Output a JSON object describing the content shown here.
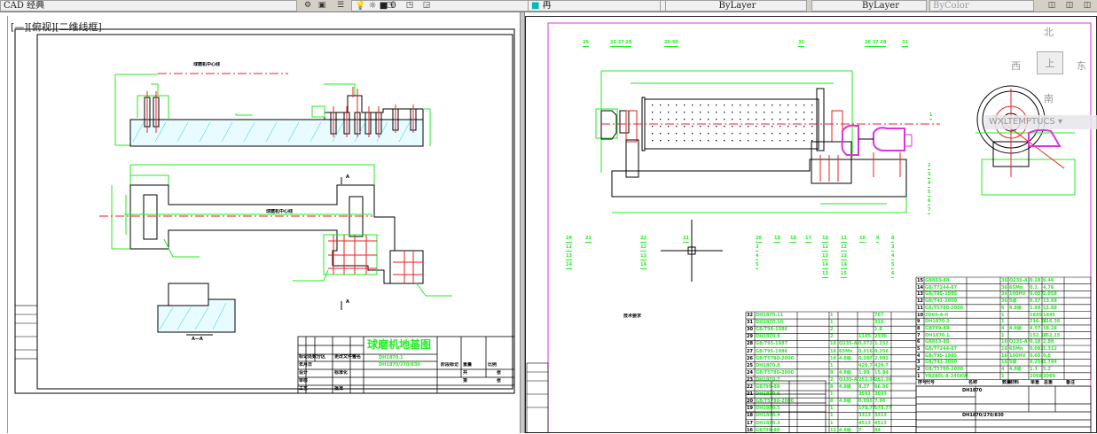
{
  "toolbar": {
    "workspace": "CAD 经典",
    "layer_color": "0",
    "layer_name": "冉",
    "color": "ByLayer",
    "linetype": "ByLayer",
    "lineweight": "ByColor"
  },
  "left_viewport": {
    "label": "[—][俯视][二维线框]",
    "drawing_title": "球磨机地基图",
    "center_label": "球磨机中心线",
    "axis_label": "球磨机中心线",
    "section_label": "A—A",
    "section_mark": "A",
    "title_block": {
      "code": "DH1870.1",
      "subcode": "DH1870/270/830",
      "fields": [
        "标记",
        "处数",
        "分区",
        "更改文件号",
        "签名",
        "年月日",
        "设计",
        "标准化",
        "审核",
        "工艺",
        "批准",
        "阶段标记",
        "重量",
        "比例",
        "共",
        "张",
        "第",
        "张"
      ]
    }
  },
  "right_viewport": {
    "viewcube": {
      "north": "北",
      "south": "南",
      "east": "东",
      "west": "西",
      "top": "上"
    },
    "ucs_label": "WXLTEMPTUCS",
    "balloons_top": [
      "25",
      "26 27 28",
      "29 30",
      "31",
      "26 27 28",
      "32",
      "1"
    ],
    "balloons_bottom": [
      "24",
      "12",
      "13",
      "14",
      "23",
      "22",
      "12",
      "13",
      "14",
      "21",
      "20",
      "3",
      "4",
      "5",
      "19",
      "18",
      "17",
      "16",
      "12",
      "13",
      "14",
      "15",
      "11",
      "12",
      "13",
      "14",
      "15",
      "10",
      "9",
      "8",
      "3",
      "4",
      "5",
      "6"
    ],
    "balloons_right": [
      "2",
      "3",
      "4",
      "5",
      "6",
      "7"
    ],
    "notes_title": "技术要求",
    "parts_list_left": [
      {
        "no": "32",
        "code": "DH1870.11",
        "qty": "1",
        "total": "767"
      },
      {
        "no": "31",
        "code": "DH1870.10",
        "qty": "1",
        "total": "316"
      },
      {
        "no": "30",
        "code": "GB/T98-1986",
        "qty": "2",
        "total": "1.8"
      },
      {
        "no": "29",
        "code": "DH1870.9",
        "qty": "2",
        "unit": "1165",
        "total": "2330"
      },
      {
        "no": "28",
        "code": "GB/T95-1987",
        "qty": "16",
        "material": "Q235-A",
        "unit": "0.072",
        "total": "1.152"
      },
      {
        "no": "27",
        "code": "GB/T95-1986",
        "qty": "16",
        "material": "65Mn",
        "unit": "0.016",
        "total": "0.256"
      },
      {
        "no": "26",
        "code": "GB/T5780-2000",
        "qty": "16",
        "material": "4.8级",
        "unit": "0.187",
        "total": "2.992"
      },
      {
        "no": "25",
        "code": "DH1870.8",
        "qty": "1",
        "unit": "429.7",
        "total": "429.7"
      },
      {
        "no": "24",
        "code": "GB/T5780-2000",
        "qty": "8",
        "material": "4.8级",
        "unit": "1.98",
        "total": "15.84"
      },
      {
        "no": "23",
        "code": "DH1870.7",
        "qty": "2",
        "material": "Q235-A",
        "unit": "252.36",
        "total": "252.36"
      },
      {
        "no": "22",
        "code": "GB799-88",
        "qty": "8",
        "material": "4.8级",
        "unit": "8.37",
        "total": "66.96"
      },
      {
        "no": "21",
        "code": "DH1870.6",
        "qty": "1",
        "unit": "3593",
        "total": "3593"
      },
      {
        "no": "20",
        "code": "GB/T5780-2000",
        "qty": "8",
        "material": "4.8级",
        "unit": "0.995",
        "total": "7.96"
      },
      {
        "no": "19",
        "code": "DH1870.5",
        "qty": "1",
        "unit": "178.77",
        "total": "178.77"
      },
      {
        "no": "18",
        "code": "DH1870.4",
        "qty": "1",
        "unit": "3313",
        "total": "3313"
      },
      {
        "no": "17",
        "code": "DH1870.3",
        "qty": "1",
        "unit": "4513",
        "total": "4513"
      },
      {
        "no": "16",
        "code": "GB799-88",
        "qty": "12",
        "material": "4.8级",
        "unit": "7",
        "total": "84"
      }
    ],
    "parts_list_right": [
      {
        "no": "15",
        "code": "GB853-88",
        "qty": "36",
        "material": "Q235-A",
        "unit": "0.18",
        "total": "6.46"
      },
      {
        "no": "14",
        "code": "GB/T7244-87",
        "qty": "36",
        "material": "65Mn",
        "unit": "0.1",
        "total": "4.76"
      },
      {
        "no": "13",
        "code": "GB/T95-1985",
        "qty": "36",
        "material": "100HV",
        "unit": "0.057",
        "total": "2.058"
      },
      {
        "no": "12",
        "code": "GB/T41-2000",
        "qty": "36",
        "material": "5级",
        "unit": "0.37",
        "total": "13.68"
      },
      {
        "no": "11",
        "code": "GB/T5780-2000",
        "qty": "6",
        "material": "4.8级",
        "unit": "1.98",
        "total": "11.88"
      },
      {
        "no": "10",
        "code": "ZD60-4-II",
        "qty": "1",
        "unit": "1845",
        "total": "1845"
      },
      {
        "no": "9",
        "code": "DH1870.2",
        "qty": "1",
        "unit": "216.36",
        "total": "216.36"
      },
      {
        "no": "8",
        "code": "GB799-88",
        "qty": "4",
        "material": "4.8级",
        "unit": "4.57",
        "total": "18.28"
      },
      {
        "no": "7",
        "code": "DH1870.1",
        "qty": "1",
        "unit": "152.15",
        "total": "152.15"
      },
      {
        "no": "6",
        "code": "GB853-88",
        "qty": "16",
        "material": "Q235-A",
        "unit": "0.18",
        "total": "2.88"
      },
      {
        "no": "5",
        "code": "GB/T7244-87",
        "qty": "16",
        "material": "65Mn",
        "unit": "0.082",
        "total": "1.312"
      },
      {
        "no": "4",
        "code": "GB/T95-1985",
        "qty": "16",
        "material": "100HV",
        "unit": "0.05",
        "total": "0.8"
      },
      {
        "no": "3",
        "code": "GB/T41-2000",
        "qty": "16",
        "material": "5级",
        "unit": "0.234",
        "total": "3.744"
      },
      {
        "no": "2",
        "code": "GB/T5780-2000",
        "qty": "4",
        "material": "4.8级",
        "unit": "1.3",
        "total": "5.2"
      },
      {
        "no": "1",
        "code": "YR280L-8-245KW",
        "qty": "1",
        "unit": "2069",
        "total": "2069"
      }
    ],
    "parts_header": [
      "序号",
      "代号",
      "名称",
      "数量",
      "材料",
      "单重",
      "总重",
      "备注"
    ],
    "title_block": {
      "code": "DH1870",
      "subcode": "DH1870/270/830"
    }
  },
  "colors": {
    "green": "#22ee22",
    "red": "#ee2222",
    "magenta": "#dd22dd",
    "cyan": "#22dddd",
    "frame": "#000000"
  }
}
